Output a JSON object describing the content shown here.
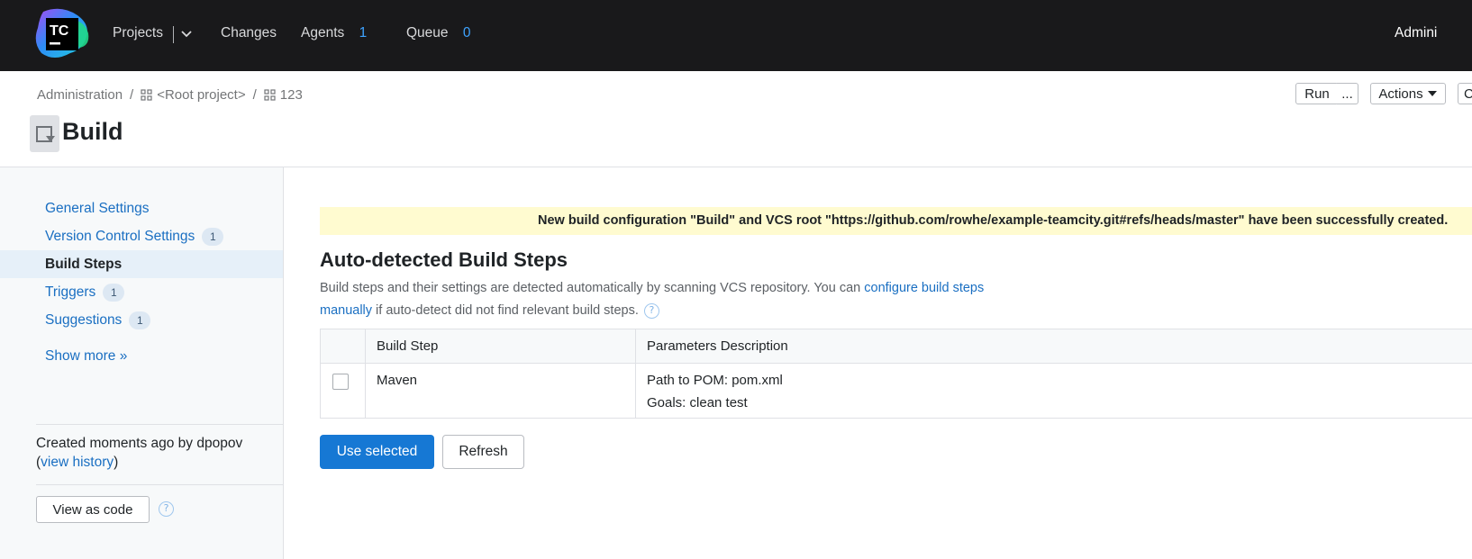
{
  "topbar": {
    "logo_text": "TC",
    "nav": {
      "projects": "Projects",
      "changes": "Changes",
      "agents": "Agents",
      "agents_count": "1",
      "queue": "Queue",
      "queue_count": "0"
    },
    "user": "Admini"
  },
  "header": {
    "breadcrumb": [
      "Administration",
      "/",
      "<Root project>",
      "/",
      "123"
    ],
    "title": "Build",
    "run_label": "Run",
    "more_label": "...",
    "actions_label": "Actions",
    "clipped_label": "C"
  },
  "sidebar": {
    "items": [
      {
        "label": "General Settings",
        "badge": ""
      },
      {
        "label": "Version Control Settings",
        "badge": "1"
      },
      {
        "label": "Build Steps",
        "badge": ""
      },
      {
        "label": "Triggers",
        "badge": "1"
      },
      {
        "label": "Suggestions",
        "badge": "1"
      }
    ],
    "active_index": 2,
    "show_more": "Show more »",
    "created_text": "Created moments ago by dpopov",
    "history_open": "(",
    "history_link": "view history",
    "history_close": ")",
    "view_as_code": "View as code",
    "help_glyph": "?"
  },
  "main": {
    "banner": "New build configuration \"Build\" and VCS root \"https://github.com/rowhe/example-teamcity.git#refs/heads/master\" have been successfully created.",
    "section_title": "Auto-detected Build Steps",
    "description_pre": "Build steps and their settings are detected automatically by scanning VCS repository. You can ",
    "description_link": "configure build steps manually",
    "description_post": " if auto-detect did not find relevant build steps.",
    "help_glyph": "?",
    "table": {
      "headers": [
        "Build Step",
        "Parameters Description"
      ],
      "rows": [
        {
          "step": "Maven",
          "params": [
            "Path to POM: pom.xml",
            "Goals: clean test"
          ],
          "checked": false
        }
      ]
    },
    "use_selected": "Use selected",
    "refresh": "Refresh"
  },
  "colors": {
    "topbar_bg": "#19191b",
    "accent": "#1678d4",
    "link": "#1a6fc2",
    "banner_bg": "#fffbd0",
    "count": "#3ea3ff"
  }
}
